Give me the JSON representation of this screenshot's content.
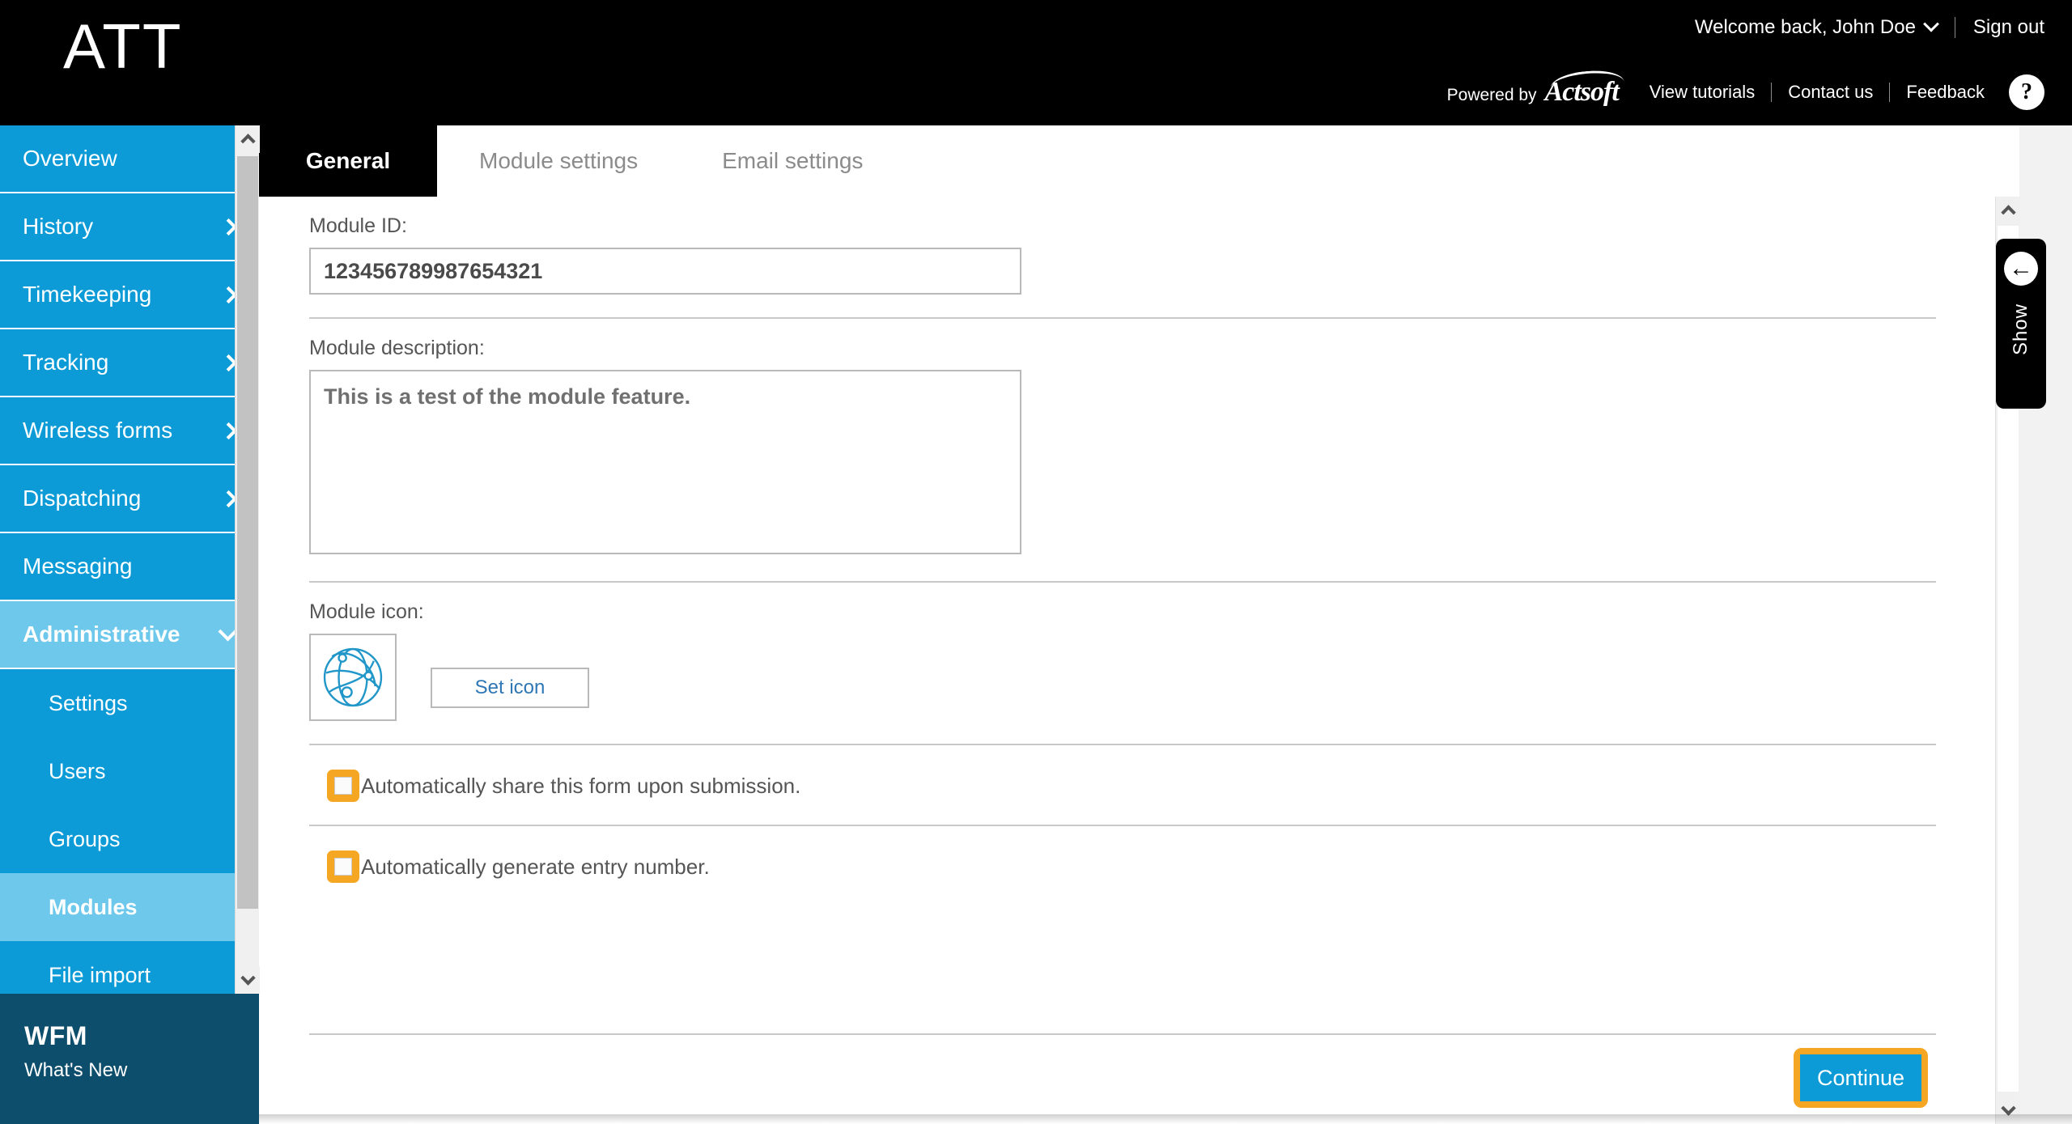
{
  "header": {
    "logo": "ATT",
    "welcome": "Welcome back, John Doe",
    "user_chevron_icon": "chevron-down-icon",
    "sign_out": "Sign out",
    "powered_by": "Powered by",
    "brand": "Actsoft",
    "links": [
      "View tutorials",
      "Contact us",
      "Feedback"
    ],
    "help": "?"
  },
  "sidebar": {
    "items": [
      {
        "label": "Overview",
        "icon": "",
        "active": false,
        "sub": false
      },
      {
        "label": "History",
        "icon": "chevron-right-icon",
        "active": false,
        "sub": false
      },
      {
        "label": "Timekeeping",
        "icon": "chevron-right-icon",
        "active": false,
        "sub": false
      },
      {
        "label": "Tracking",
        "icon": "chevron-right-icon",
        "active": false,
        "sub": false
      },
      {
        "label": "Wireless forms",
        "icon": "chevron-right-icon",
        "active": false,
        "sub": false
      },
      {
        "label": "Dispatching",
        "icon": "chevron-right-icon",
        "active": false,
        "sub": false
      },
      {
        "label": "Messaging",
        "icon": "",
        "active": false,
        "sub": false
      },
      {
        "label": "Administrative",
        "icon": "chevron-down-icon",
        "active": true,
        "sub": false
      },
      {
        "label": "Settings",
        "icon": "",
        "active": false,
        "sub": true
      },
      {
        "label": "Users",
        "icon": "",
        "active": false,
        "sub": true
      },
      {
        "label": "Groups",
        "icon": "",
        "active": false,
        "sub": true
      },
      {
        "label": "Modules",
        "icon": "",
        "active": true,
        "sub": true
      },
      {
        "label": "File import",
        "icon": "",
        "active": false,
        "sub": true
      }
    ],
    "footer": {
      "title": "WFM",
      "subtitle": "What's New"
    }
  },
  "tabs": [
    {
      "label": "General",
      "active": true
    },
    {
      "label": "Module settings",
      "active": false
    },
    {
      "label": "Email settings",
      "active": false
    }
  ],
  "form": {
    "module_id_label": "Module ID:",
    "module_id_value": "123456789987654321",
    "module_description_label": "Module description:",
    "module_description_value": "This is a test of the module feature.",
    "module_icon_label": "Module icon:",
    "module_icon_name": "globe-network-icon",
    "set_icon_button": "Set icon",
    "checkboxes": [
      {
        "label": "Automatically share this form upon submission.",
        "checked": false
      },
      {
        "label": "Automatically generate entry number.",
        "checked": false
      }
    ],
    "continue_button": "Continue"
  },
  "show_panel": {
    "label": "Show",
    "icon": "arrow-left-circle-icon"
  },
  "colors": {
    "brand_blue": "#0c9bd7",
    "active_blue": "#6dc8ec",
    "highlight_orange": "#f5a623",
    "footer_navy": "#0d4e6c",
    "header_black": "#000000"
  }
}
